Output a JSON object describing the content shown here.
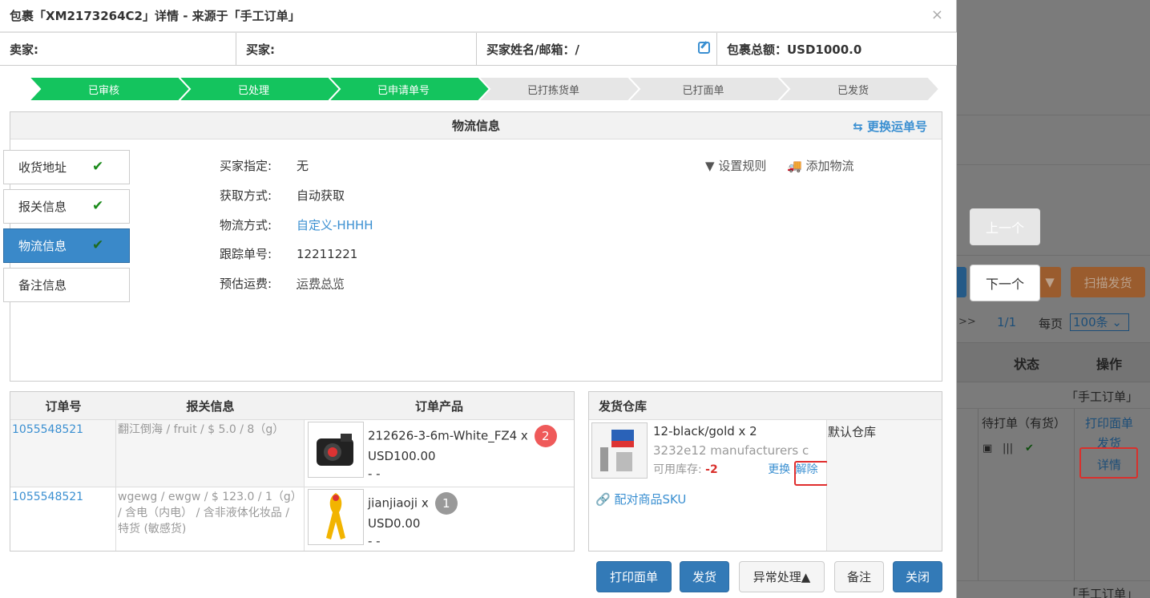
{
  "modal": {
    "title": "包裹「XM2173264C2」详情 - 来源于「手工订单」",
    "close": "×",
    "info": {
      "seller": "卖家:",
      "buyer": "买家:",
      "buyer_email": "买家姓名/邮箱：/",
      "total": "包裹总额：USD1000.0"
    },
    "steps": [
      {
        "label": "已审核",
        "done": true
      },
      {
        "label": "已处理",
        "done": true
      },
      {
        "label": "已申请单号",
        "done": true
      },
      {
        "label": "已打拣货单",
        "done": false
      },
      {
        "label": "已打面单",
        "done": false
      },
      {
        "label": "已发货",
        "done": false
      }
    ],
    "logistics": {
      "title": "物流信息",
      "swap_link": "更换运单号",
      "tabs": [
        "收货地址",
        "报关信息",
        "物流信息",
        "备注信息"
      ],
      "active_tab": 2,
      "fields": [
        {
          "key": "买家指定:",
          "value": "无"
        },
        {
          "key": "获取方式:",
          "value": "自动获取"
        },
        {
          "key": "物流方式:",
          "value": "自定义-HHHH"
        },
        {
          "key": "跟踪单号:",
          "value": "12211221"
        },
        {
          "key": "预估运费:",
          "value": "运费总览"
        }
      ],
      "set_rule": "设置规则",
      "add_logistics": "添加物流"
    },
    "orders": {
      "headers": [
        "订单号",
        "报关信息",
        "订单产品"
      ],
      "rows": [
        {
          "order_no": "1055548521",
          "customs": "翻江倒海 / fruit / $ 5.0 / 8（g）",
          "product": "212626-3-6m-White_FZ4 x",
          "price": "USD100.00",
          "extra": "- -",
          "qty": "2"
        },
        {
          "order_no": "1055548521",
          "customs": "wgewg / ewgw / $ 123.0 / 1（g） / 含电（内电） / 含非液体化妆品 / 特货 (敏感货)",
          "product": "jianjiaoji x",
          "price": "USD0.00",
          "extra": "- -",
          "qty": "1"
        }
      ]
    },
    "warehouse": {
      "title": "发货仓库",
      "item": "12-black/gold x 2",
      "manufacturer": "3232e12 manufacturers c",
      "stock_label": "可用库存:",
      "stock_value": "-2",
      "replace": "更换",
      "release": "解除",
      "pair_sku": "配对商品SKU",
      "default_wh": "默认仓库"
    },
    "footer": {
      "print_label": "打印面单",
      "ship": "发货",
      "exception": "异常处理▲",
      "note": "备注",
      "close": "关闭"
    }
  },
  "background": {
    "prev": "上一个",
    "next": "下一个",
    "scan_ship": "扫描发货",
    "pager_next": ">>",
    "page": "1/1",
    "per_page_label": "每页",
    "per_page": "100条",
    "col_status": "状态",
    "col_action": "操作",
    "source1": "「手工订单」",
    "status": "待打单（有货）",
    "action_print": "打印面单",
    "action_ship": "发货",
    "action_detail": "详情",
    "source2": "「手工订单」"
  }
}
